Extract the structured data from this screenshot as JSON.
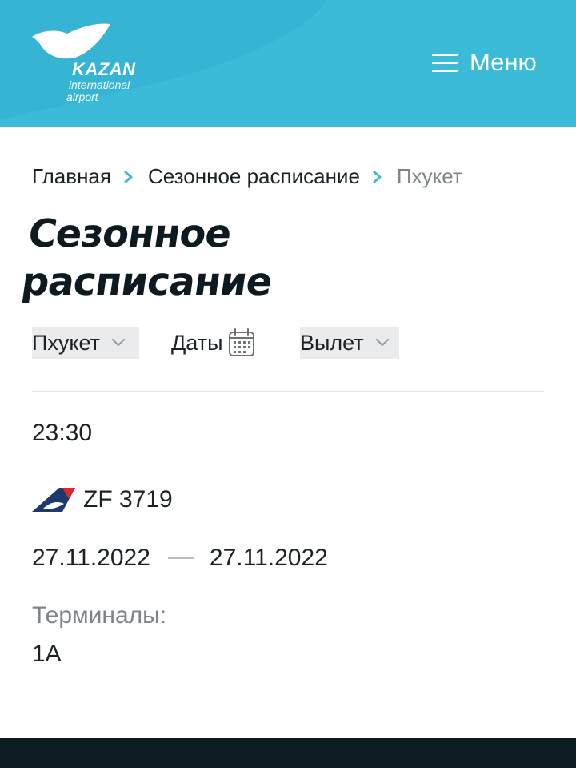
{
  "header": {
    "logo": {
      "brand": "KAZAN",
      "line1": "international",
      "line2": "airport"
    },
    "menu_label": "Меню",
    "background_color": "#3cbbd8"
  },
  "breadcrumb": [
    {
      "label": "Главная"
    },
    {
      "label": "Сезонное расписание"
    },
    {
      "label": "Пхукет"
    }
  ],
  "page_title": {
    "line1": "Сезонное",
    "line2": "расписание"
  },
  "filters": {
    "destination": "Пхукет",
    "dates_label": "Даты",
    "direction": "Вылет"
  },
  "flight": {
    "time": "23:30",
    "airline_icon": "airline-tail-logo",
    "code": "ZF 3719",
    "date_from": "27.11.2022",
    "date_to": "27.11.2022",
    "terminals_label": "Терминалы:",
    "terminals_value": "1A"
  },
  "colors": {
    "accent": "#3cbbd8",
    "text": "#1a2226",
    "muted": "#7e8589",
    "footer": "#0c1c21"
  }
}
